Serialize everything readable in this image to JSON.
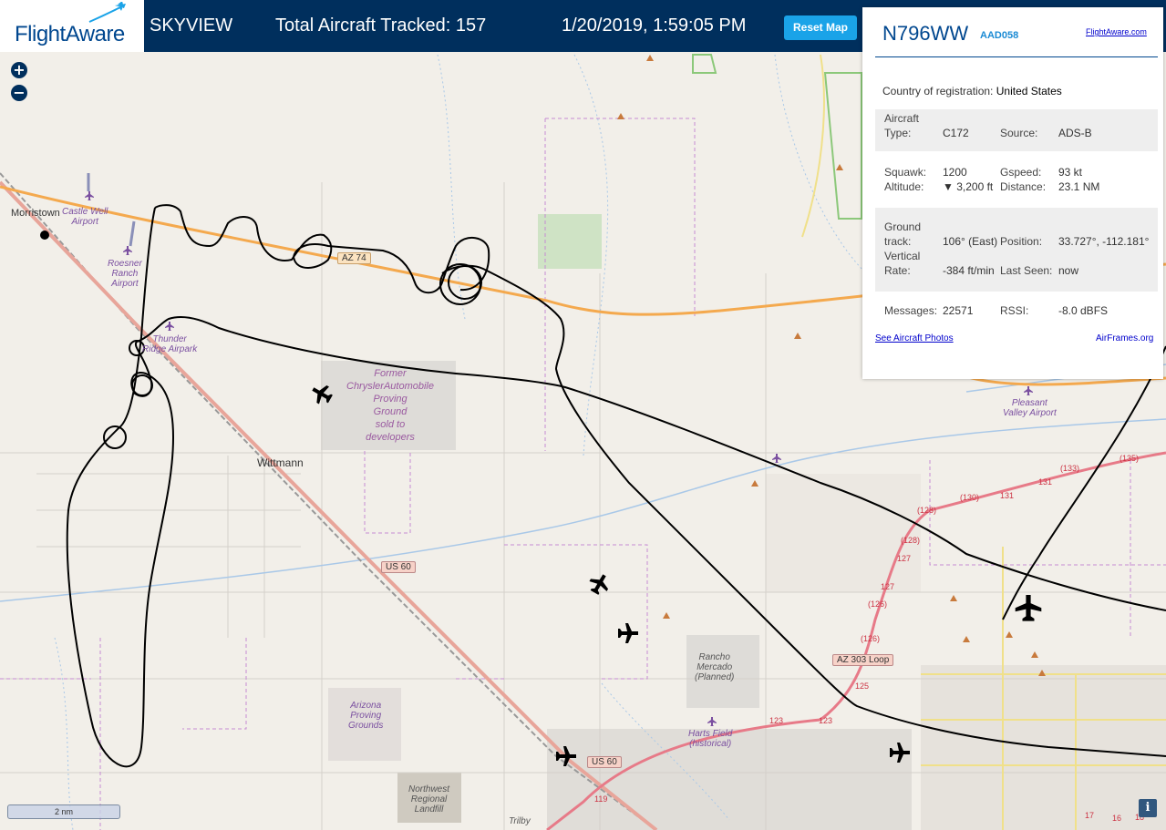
{
  "header": {
    "logo": "FlightAware",
    "skyview": "SKYVIEW",
    "total_aircraft": "Total Aircraft Tracked: 157",
    "datetime": "1/20/2019, 1:59:05 PM",
    "reset_button": "Reset Map"
  },
  "map_controls": {
    "zoom_in": "+",
    "zoom_out": "−",
    "scale": "2 nm",
    "info": "i"
  },
  "map_labels": {
    "morristown": "Morristown",
    "castle_well_1": "Castle Well",
    "castle_well_2": "Airport",
    "roesner_1": "Roesner",
    "roesner_2": "Ranch",
    "roesner_3": "Airport",
    "thunder_1": "Thunder",
    "thunder_2": "Ridge Airpark",
    "chrysler_1": "Former",
    "chrysler_2": "ChryslerAutomobile",
    "chrysler_3": "Proving",
    "chrysler_4": "Ground",
    "chrysler_5": "sold to",
    "chrysler_6": "developers",
    "wittmann": "Wittmann",
    "az74": "AZ 74",
    "us60_a": "US 60",
    "us60_b": "US 60",
    "az303": "AZ 303 Loop",
    "pleasant_1": "Pleasant",
    "pleasant_2": "Valley Airport",
    "rancho_1": "Rancho",
    "rancho_2": "Mercado",
    "rancho_3": "(Planned)",
    "arizona_1": "Arizona",
    "arizona_2": "Proving",
    "arizona_3": "Grounds",
    "harts_1": "Harts Field",
    "harts_2": "(historical)",
    "northwest_1": "Northwest",
    "northwest_2": "Regional",
    "northwest_3": "Landfill",
    "trilby": "Trilby",
    "route_labels": [
      "(135)",
      "(133)",
      "131",
      "131",
      "(130)",
      "(128)",
      "(128)",
      "127",
      "127",
      "(126)",
      "(126)",
      "125",
      "123",
      "123",
      "119",
      "17",
      "16",
      "18"
    ]
  },
  "panel": {
    "registration": "N796WW",
    "callsign": "AAD058",
    "flightaware_link": "FlightAware.com",
    "country_label": "Country of registration:",
    "country_value": "United States",
    "aircraft_type_label_1": "Aircraft",
    "aircraft_type_label_2": "Type:",
    "aircraft_type_value": "C172",
    "source_label": "Source:",
    "source_value": "ADS-B",
    "squawk_label": "Squawk:",
    "squawk_value": "1200",
    "gspeed_label": "Gspeed:",
    "gspeed_value": "93 kt",
    "altitude_label": "Altitude:",
    "altitude_value": "▼ 3,200 ft",
    "distance_label": "Distance:",
    "distance_value": "23.1 NM",
    "ground_track_label_1": "Ground",
    "ground_track_label_2": "track:",
    "ground_track_value": "106° (East)",
    "position_label": "Position:",
    "position_value": "33.727°, -112.181°",
    "vertical_rate_label_1": "Vertical",
    "vertical_rate_label_2": "Rate:",
    "vertical_rate_value": "-384 ft/min",
    "last_seen_label": "Last Seen:",
    "last_seen_value": "now",
    "messages_label": "Messages:",
    "messages_value": "22571",
    "rssi_label": "RSSI:",
    "rssi_value": "-8.0 dBFS",
    "aircraft_photos_link": "See Aircraft Photos",
    "airframes_link": "AirFrames.org"
  },
  "colors": {
    "header_bg": "#002f5d",
    "accent": "#1aa3e8",
    "brand": "#00478f",
    "track": "#000000",
    "highway": "#f4a94e",
    "boundary": "#c58bd4"
  },
  "icons": [
    "plane-icon",
    "airport-icon",
    "peak-icon",
    "zoom-in-icon",
    "zoom-out-icon",
    "info-icon"
  ]
}
